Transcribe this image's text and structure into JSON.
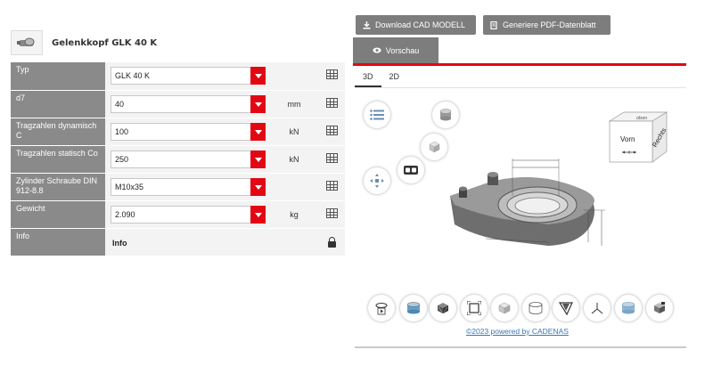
{
  "product": {
    "title": "Gelenkkopf GLK 40 K"
  },
  "params": [
    {
      "label": "Typ",
      "value": "GLK 40 K",
      "unit": "",
      "action": "table-icon"
    },
    {
      "label": "d7",
      "value": "40",
      "unit": "mm",
      "action": "table-icon"
    },
    {
      "label": "Tragzahlen dynamisch C",
      "value": "100",
      "unit": "kN",
      "action": "table-icon"
    },
    {
      "label": "Tragzahlen statisch Co",
      "value": "250",
      "unit": "kN",
      "action": "table-icon"
    },
    {
      "label": "Zylinder Schraube DIN 912-8.8",
      "value": "M10x35",
      "unit": "",
      "action": "table-icon"
    },
    {
      "label": "Gewicht",
      "value": "2.090",
      "unit": "kg",
      "action": "table-icon"
    },
    {
      "label": "Info",
      "value": "Info",
      "unit": "",
      "action": "lock-icon"
    }
  ],
  "toolbar": {
    "download_cad": "Download CAD MODELL",
    "generate_pdf": "Generiere PDF-Datenblatt"
  },
  "tabs": {
    "preview": "Vorschau"
  },
  "subtabs": [
    "3D",
    "2D"
  ],
  "viewcube": {
    "front": "Vorn",
    "right": "Rechts"
  },
  "copyright": "©2023 powered by CADENAS",
  "colors": {
    "accent": "#e30613",
    "button_bg": "#7d7d7d",
    "label_bg": "#8a8a8a",
    "link": "#3a78b5"
  }
}
